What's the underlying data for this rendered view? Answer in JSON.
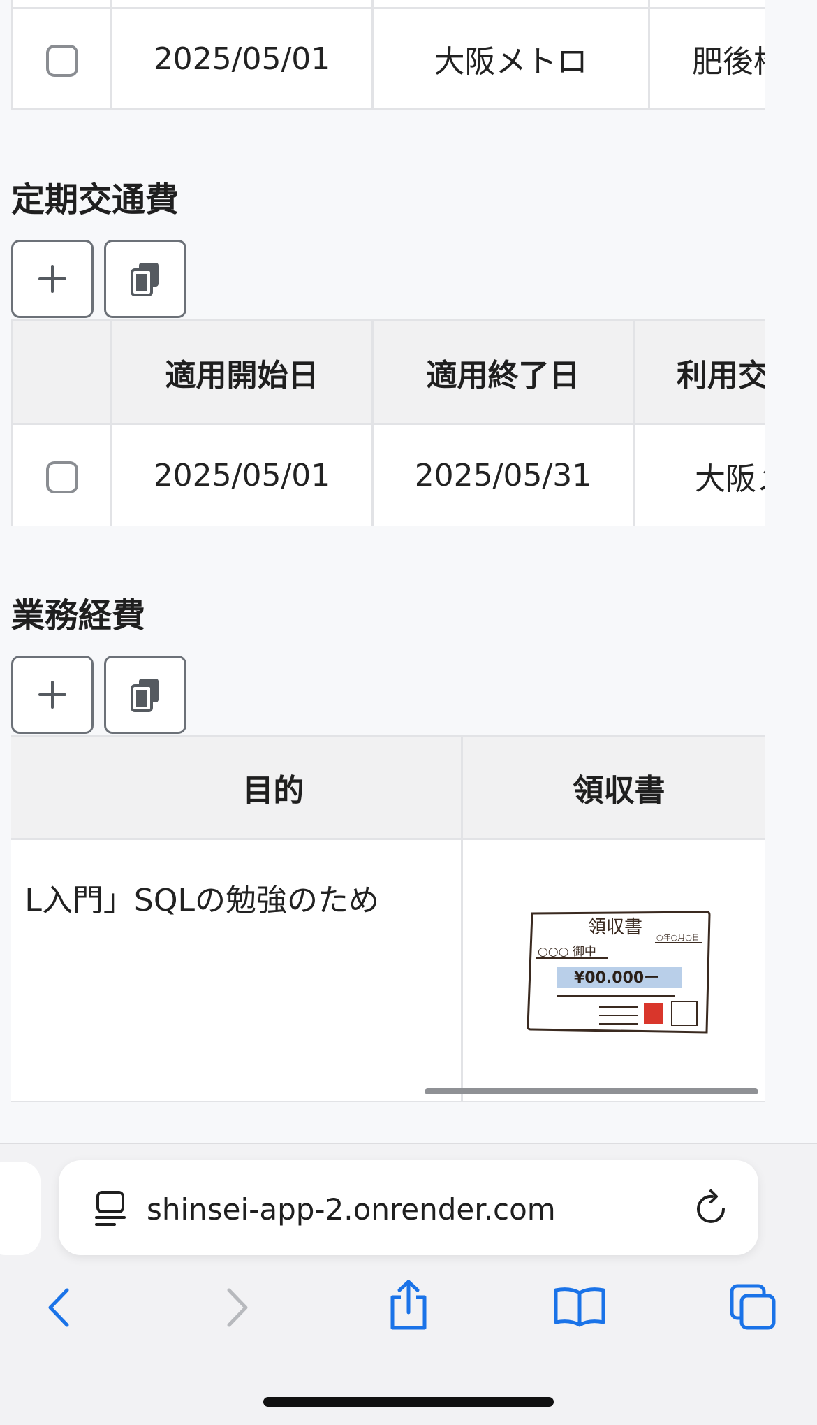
{
  "table1": {
    "row": {
      "date": "2025/05/01",
      "route": "大阪メトロ",
      "station": "肥後橋"
    }
  },
  "section2": {
    "title": "定期交通費",
    "headers": [
      "",
      "適用開始日",
      "適用終了日",
      "利用交通機関"
    ],
    "row": {
      "start": "2025/05/01",
      "end": "2025/05/31",
      "route": "大阪メトロ"
    }
  },
  "section3": {
    "title": "業務経費",
    "headers": [
      "目的",
      "領収書"
    ],
    "row": {
      "purpose": "「SQL入門」SQLの勉強のため"
    },
    "receipt": {
      "title": "領収書",
      "date": "○年○月○日",
      "to": "○○○ 御中",
      "amount": "¥00.000ー"
    }
  },
  "browser": {
    "url": "shinsei-app-2.onrender.com"
  },
  "colors": {
    "accent": "#1a73e8",
    "border": "#e2e3e6",
    "header_bg": "#f1f1f2"
  },
  "icons": [
    "plus-icon",
    "copy-icon",
    "reader-mode-icon",
    "reload-icon",
    "back-icon",
    "forward-icon",
    "share-icon",
    "bookmarks-icon",
    "tabs-icon"
  ]
}
